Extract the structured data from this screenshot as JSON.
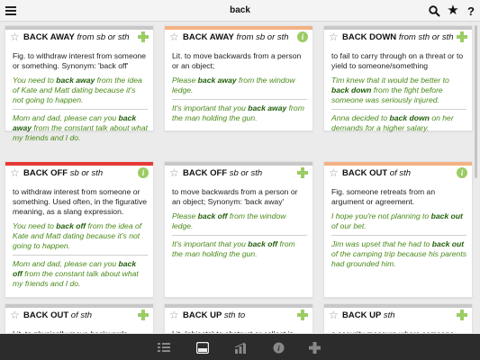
{
  "app": {
    "title": "back"
  },
  "colors": {
    "green": "#9ccc65",
    "orange": "#f4b183",
    "red": "#e53935",
    "gray": "#c8c8c8"
  },
  "cards": [
    {
      "head": "BACK AWAY",
      "gram": "from sb or sth",
      "strip": "#c8c8c8",
      "action": "plus",
      "def": "Fig. to withdraw interest from someone or something. Synonym: 'back off'",
      "examples": [
        [
          "You need to ",
          "back away",
          " from the idea of Kate and Matt dating because it's not going to happen."
        ],
        [
          "Mom and dad, please can you ",
          "back away",
          " from the constant talk about what my friends and I do."
        ]
      ]
    },
    {
      "head": "BACK AWAY",
      "gram": "from sb or sth",
      "strip": "#f4b183",
      "action": "info",
      "def": "Lit. to move backwards from a person or an object;",
      "examples": [
        [
          "Please ",
          "back away",
          " from the window ledge."
        ],
        [
          "It's important that you ",
          "back away",
          " from the man holding the gun."
        ]
      ]
    },
    {
      "head": "BACK DOWN",
      "gram": "from sth or sth",
      "strip": "#c8c8c8",
      "action": "plus",
      "def": "to fail to carry through on a threat or to yield to someone/something",
      "examples": [
        [
          "Tim knew that it would be better to ",
          "back down",
          " from the fight before someone was seriously injured."
        ],
        [
          "Anna decided to ",
          "back down",
          " on her demands for a higher salary."
        ]
      ]
    },
    {
      "head": "BACK OFF",
      "gram": "sb or sth",
      "strip": "#e53935",
      "action": "info",
      "def": "to withdraw interest from someone or something. Used often, in the figurative meaning, as a slang expression.",
      "examples": [
        [
          "You need to ",
          "back off",
          " from the idea of Kate and Matt dating because it's not going to happen."
        ],
        [
          "Mom and dad, please can you ",
          "back off",
          " from the constant talk about what my friends and I do."
        ]
      ]
    },
    {
      "head": "BACK OFF",
      "gram": "sb or sth",
      "strip": "#c8c8c8",
      "action": "plus",
      "def": "to move backwards from a person or an object; Synonym: 'back away'",
      "examples": [
        [
          "Please ",
          "back off",
          " from the window ledge."
        ],
        [
          "It's important that you ",
          "back off",
          " from the man holding the gun."
        ]
      ]
    },
    {
      "head": "BACK OUT",
      "gram": "of sth",
      "strip": "#f4b183",
      "action": "info",
      "def": "Fig. someone retreats from an argument or agreement.",
      "examples": [
        [
          "I hope you're not planning to ",
          "back out",
          " of our bet."
        ],
        [
          "Jim was upset that he had to ",
          "back out",
          " of the camping trip because his parents had grounded him."
        ]
      ]
    },
    {
      "head": "BACK OUT",
      "gram": "of sth",
      "strip": "#c8c8c8",
      "action": "plus",
      "def": "Lit. to physically move backwards",
      "examples": []
    },
    {
      "head": "BACK UP",
      "gram": "sth to",
      "strip": "#c8c8c8",
      "action": "plus",
      "def": "Lit. (objects) to obstruct or collect in",
      "examples": []
    },
    {
      "head": "BACK UP",
      "gram": "sth",
      "strip": "#c8c8c8",
      "action": "plus",
      "def": "a security measure where someone",
      "examples": []
    }
  ],
  "bottom_nav": [
    "list-icon",
    "cards-icon",
    "chart-icon",
    "info-icon",
    "add-icon"
  ]
}
